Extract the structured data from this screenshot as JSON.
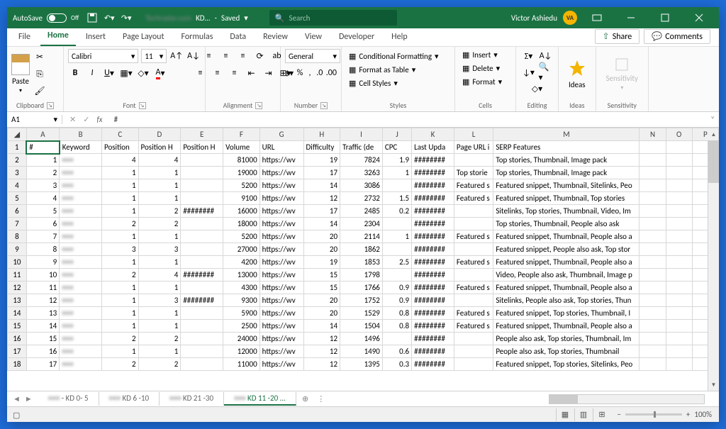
{
  "titlebar": {
    "autosave": "AutoSave",
    "autosave_state": "Off",
    "doc_blur": "Techradar.com",
    "doc_suffix": "KD...",
    "saved": "Saved",
    "search_placeholder": "Search",
    "user": "Victor Ashiedu",
    "initials": "VA"
  },
  "menu": {
    "items": [
      "File",
      "Home",
      "Insert",
      "Page Layout",
      "Formulas",
      "Data",
      "Review",
      "View",
      "Developer",
      "Help"
    ],
    "active": 1,
    "share": "Share",
    "comments": "Comments"
  },
  "ribbon": {
    "clipboard": "Clipboard",
    "paste": "Paste",
    "font": "Font",
    "font_name": "Calibri",
    "font_size": "11",
    "alignment": "Alignment",
    "number": "Number",
    "number_fmt": "General",
    "styles": "Styles",
    "cf": "Conditional Formatting",
    "fat": "Format as Table",
    "cs": "Cell Styles",
    "cells": "Cells",
    "insert": "Insert",
    "delete": "Delete",
    "format": "Format",
    "editing": "Editing",
    "ideas": "Ideas",
    "sensitivity": "Sensitivity"
  },
  "namebox": {
    "ref": "A1",
    "value": "#"
  },
  "columns": [
    "A",
    "B",
    "C",
    "D",
    "E",
    "F",
    "G",
    "H",
    "I",
    "J",
    "K",
    "L",
    "M",
    "N",
    "O",
    "P"
  ],
  "headers": {
    "A": "#",
    "B": "Keyword",
    "C": "Position",
    "D": "Position H",
    "E": "Position H",
    "F": "Volume",
    "G": "URL",
    "H": "Difficulty",
    "I": "Traffic (de",
    "J": "CPC",
    "K": "Last Upda",
    "L": "Page URL i",
    "M": "SERP Features"
  },
  "rows": [
    {
      "n": 1,
      "kw": "•••",
      "pos": 4,
      "ph1": 4,
      "ph2": "",
      "vol": 81000,
      "url": "https://wv",
      "diff": 19,
      "tr": 7824,
      "cpc": 1.9,
      "lu": "########",
      "purl": "",
      "serp": "Top stories, Thumbnail, Image pack"
    },
    {
      "n": 2,
      "kw": "•••",
      "pos": 1,
      "ph1": 1,
      "ph2": "",
      "vol": 19000,
      "url": "https://wv",
      "diff": 17,
      "tr": 3263,
      "cpc": 1,
      "lu": "########",
      "purl": "Top storie",
      "serp": "Top stories, Thumbnail, Image pack"
    },
    {
      "n": 3,
      "kw": "•••",
      "pos": 1,
      "ph1": 1,
      "ph2": "",
      "vol": 5200,
      "url": "https://wv",
      "diff": 14,
      "tr": 3086,
      "cpc": "",
      "lu": "########",
      "purl": "Featured s",
      "serp": "Featured snippet, Thumbnail, Sitelinks, Peo"
    },
    {
      "n": 4,
      "kw": "•••",
      "pos": 1,
      "ph1": 1,
      "ph2": "",
      "vol": 9100,
      "url": "https://wv",
      "diff": 12,
      "tr": 2732,
      "cpc": 1.5,
      "lu": "########",
      "purl": "Featured s",
      "serp": "Featured snippet, Thumbnail, Top stories"
    },
    {
      "n": 5,
      "kw": "•••",
      "pos": 1,
      "ph1": 2,
      "ph2": "########",
      "vol": 16000,
      "url": "https://wv",
      "diff": 17,
      "tr": 2485,
      "cpc": 0.2,
      "lu": "########",
      "purl": "",
      "serp": "Sitelinks, Top stories, Thumbnail, Video, Im"
    },
    {
      "n": 6,
      "kw": "•••",
      "pos": 2,
      "ph1": 2,
      "ph2": "",
      "vol": 18000,
      "url": "https://wv",
      "diff": 14,
      "tr": 2304,
      "cpc": "",
      "lu": "########",
      "purl": "",
      "serp": "Top stories, Thumbnail, People also ask"
    },
    {
      "n": 7,
      "kw": "•••",
      "pos": 1,
      "ph1": 1,
      "ph2": "",
      "vol": 5200,
      "url": "https://wv",
      "diff": 20,
      "tr": 2114,
      "cpc": 1,
      "lu": "########",
      "purl": "Featured s",
      "serp": "Featured snippet, Thumbnail, People also a"
    },
    {
      "n": 8,
      "kw": "•••",
      "pos": 3,
      "ph1": 3,
      "ph2": "",
      "vol": 27000,
      "url": "https://wv",
      "diff": 20,
      "tr": 1862,
      "cpc": "",
      "lu": "########",
      "purl": "",
      "serp": "Featured snippet, People also ask, Top stor"
    },
    {
      "n": 9,
      "kw": "•••",
      "pos": 1,
      "ph1": 1,
      "ph2": "",
      "vol": 4200,
      "url": "https://wv",
      "diff": 19,
      "tr": 1853,
      "cpc": 2.5,
      "lu": "########",
      "purl": "Featured s",
      "serp": "Featured snippet, Thumbnail, People also a"
    },
    {
      "n": 10,
      "kw": "•••",
      "pos": 2,
      "ph1": 4,
      "ph2": "########",
      "vol": 13000,
      "url": "https://wv",
      "diff": 15,
      "tr": 1798,
      "cpc": "",
      "lu": "########",
      "purl": "",
      "serp": "Video, People also ask, Thumbnail, Image p"
    },
    {
      "n": 11,
      "kw": "•••",
      "pos": 1,
      "ph1": 1,
      "ph2": "",
      "vol": 4300,
      "url": "https://wv",
      "diff": 15,
      "tr": 1766,
      "cpc": 0.9,
      "lu": "########",
      "purl": "Featured s",
      "serp": "Featured snippet, Thumbnail, People also a"
    },
    {
      "n": 12,
      "kw": "•••",
      "pos": 1,
      "ph1": 3,
      "ph2": "########",
      "vol": 9300,
      "url": "https://wv",
      "diff": 20,
      "tr": 1752,
      "cpc": 0.9,
      "lu": "########",
      "purl": "",
      "serp": "Sitelinks, People also ask, Top stories, Thun"
    },
    {
      "n": 13,
      "kw": "•••",
      "pos": 1,
      "ph1": 1,
      "ph2": "",
      "vol": 5900,
      "url": "https://wv",
      "diff": 20,
      "tr": 1529,
      "cpc": 0.8,
      "lu": "########",
      "purl": "Featured s",
      "serp": "Featured snippet, Top stories, Thumbnail, I"
    },
    {
      "n": 14,
      "kw": "•••",
      "pos": 1,
      "ph1": 1,
      "ph2": "",
      "vol": 2500,
      "url": "https://wv",
      "diff": 14,
      "tr": 1504,
      "cpc": 0.8,
      "lu": "########",
      "purl": "Featured s",
      "serp": "Featured snippet, Thumbnail, People also a"
    },
    {
      "n": 15,
      "kw": "•••",
      "pos": 2,
      "ph1": 2,
      "ph2": "",
      "vol": 24000,
      "url": "https://wv",
      "diff": 12,
      "tr": 1496,
      "cpc": "",
      "lu": "########",
      "purl": "",
      "serp": "People also ask, Top stories, Thumbnail, Im"
    },
    {
      "n": 16,
      "kw": "•••",
      "pos": 1,
      "ph1": 1,
      "ph2": "",
      "vol": 12000,
      "url": "https://wv",
      "diff": 12,
      "tr": 1490,
      "cpc": 0.6,
      "lu": "########",
      "purl": "",
      "serp": "People also ask, Top stories, Thumbnail"
    },
    {
      "n": 17,
      "kw": "•••",
      "pos": 2,
      "ph1": 2,
      "ph2": "",
      "vol": 11000,
      "url": "https://wv",
      "diff": 12,
      "tr": 1395,
      "cpc": 0.3,
      "lu": "########",
      "purl": "",
      "serp": "Featured snippet, Top stories, Sitelinks, Peo"
    }
  ],
  "sheets": {
    "tabs": [
      "••• - KD 0- 5",
      "••• KD 6 -10",
      "••• KD 21 -30",
      "••• KD 11 -20 ..."
    ],
    "active": 3
  },
  "status": {
    "zoom": "100%"
  }
}
